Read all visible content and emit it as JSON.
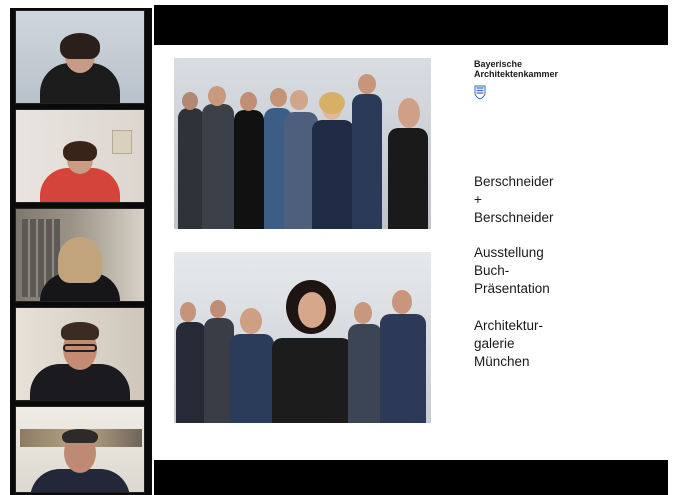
{
  "slide": {
    "organization": [
      "Bayerische",
      "Architektenkammer"
    ],
    "block1": [
      "Berschneider",
      "+",
      "Berschneider"
    ],
    "block2": [
      "Ausstellung",
      "Buch-",
      "Präsentation"
    ],
    "block3": [
      "Architektur-",
      "galerie",
      "München"
    ]
  },
  "colors": {
    "window_bg": "#ffffff",
    "participants_bg": "#0a0a0a",
    "share_frame": "#000000",
    "slide_bg": "#ffffff",
    "text": "#1a1a1a",
    "crest_blue": "#3a6fb5"
  }
}
